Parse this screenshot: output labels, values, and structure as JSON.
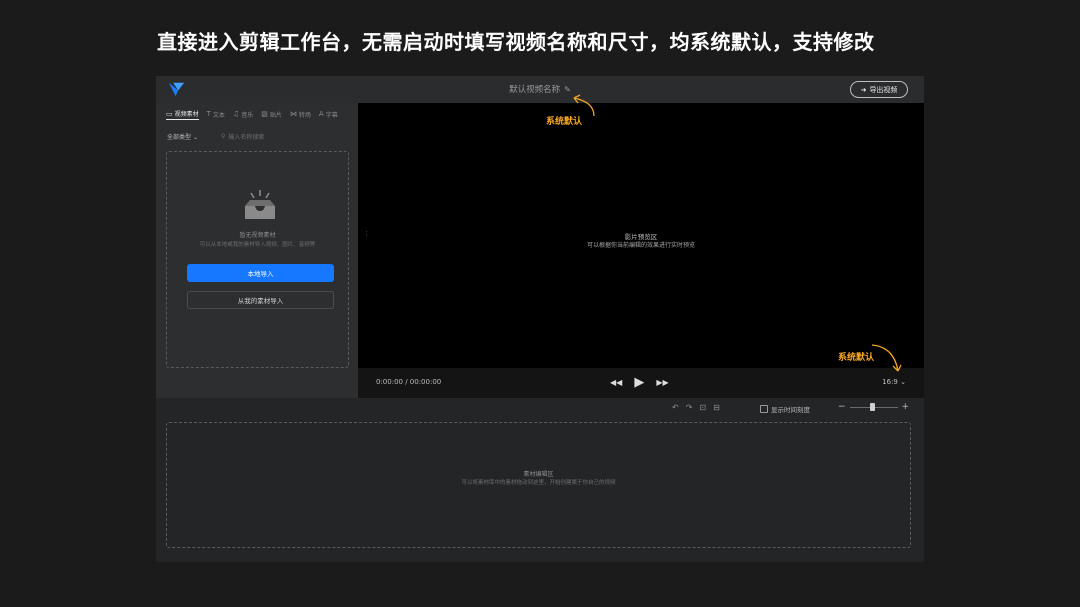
{
  "slide": {
    "title": "直接进入剪辑工作台，无需启动时填写视频名称和尺寸，均系统默认，支持修改"
  },
  "topbar": {
    "doc_title": "默认视频名称",
    "pencil_icon": "✎",
    "export_icon": "➜",
    "export_label": "导出视频"
  },
  "left_panel": {
    "tabs": [
      {
        "icon": "▭",
        "label": "视频素材"
      },
      {
        "icon": "T",
        "label": "文本"
      },
      {
        "icon": "♫",
        "label": "音乐"
      },
      {
        "icon": "▨",
        "label": "贴片"
      },
      {
        "icon": "⋈",
        "label": "转场"
      },
      {
        "icon": "A",
        "label": "字幕"
      }
    ],
    "filter_label": "全部类型",
    "search_placeholder": "输入名称搜索",
    "empty_title": "暂无视频素材",
    "empty_sub": "可以从本地或我的素材导入视频、图片、音频等",
    "local_import": "本地导入",
    "library_import": "从我的素材导入"
  },
  "preview": {
    "title": "影片预览区",
    "subtitle": "可以根据你当前编辑的效果进行实时预览",
    "timecode": "0:00:00 / 00:00:00",
    "ratio": "16:9"
  },
  "timeline": {
    "show_time_scale": "显示时间刻度",
    "edit_title": "素材编辑区",
    "edit_sub": "可以将素材库中的素材拖动到这里，开始创建属于你自己的视频"
  },
  "annotations": {
    "label1": "系统默认",
    "label2": "系统默认"
  },
  "colors": {
    "accent": "#1677ff",
    "annotation": "#f5a623",
    "background": "#1b1b1c"
  }
}
